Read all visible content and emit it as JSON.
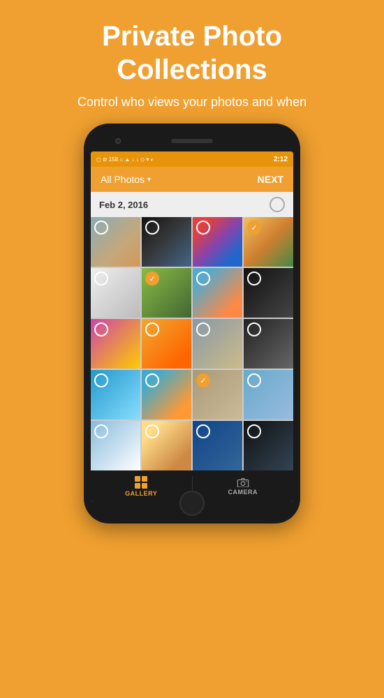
{
  "header": {
    "title_line1": "Private Photo",
    "title_line2": "Collections",
    "subtitle": "Control who views your photos and when"
  },
  "status_bar": {
    "time": "2:12",
    "icons": "◻ ⊘ 158 ⌂ ▲ ↓ ↓ ◇ ▾ ◐"
  },
  "top_bar": {
    "album_label": "All Photos",
    "dropdown_char": "▾",
    "next_label": "NEXT"
  },
  "date_section": {
    "date_label": "Feb 2, 2016"
  },
  "photos": [
    {
      "id": "p1",
      "selected": false
    },
    {
      "id": "p2",
      "selected": false
    },
    {
      "id": "p3",
      "selected": false
    },
    {
      "id": "p4",
      "selected": true
    },
    {
      "id": "p5",
      "selected": false
    },
    {
      "id": "p6",
      "selected": true
    },
    {
      "id": "p7",
      "selected": false
    },
    {
      "id": "p8",
      "selected": false
    },
    {
      "id": "p9",
      "selected": false
    },
    {
      "id": "p10",
      "selected": false
    },
    {
      "id": "p11",
      "selected": false
    },
    {
      "id": "p12",
      "selected": false
    },
    {
      "id": "p13",
      "selected": false
    },
    {
      "id": "p14",
      "selected": false
    },
    {
      "id": "p15",
      "selected": true
    },
    {
      "id": "p16",
      "selected": false
    },
    {
      "id": "p17",
      "selected": false
    },
    {
      "id": "p18",
      "selected": false
    },
    {
      "id": "p19",
      "selected": false
    },
    {
      "id": "p20",
      "selected": false
    }
  ],
  "bottom_nav": {
    "gallery_label": "GALLERY",
    "camera_label": "CAMERA"
  },
  "colors": {
    "accent": "#F0A030",
    "background": "#F0A030"
  }
}
